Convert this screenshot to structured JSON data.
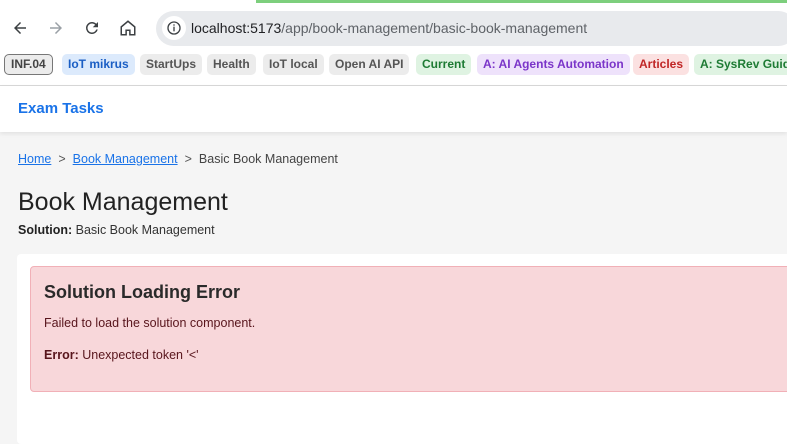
{
  "browser": {
    "url_host": "localhost:5173",
    "url_path": "/app/book-management/basic-book-management",
    "bookmarks": [
      {
        "label": "INF.04",
        "style": "outline"
      },
      {
        "label": "IoT mikrus",
        "style": "blue"
      },
      {
        "label": "StartUps",
        "style": "gray"
      },
      {
        "label": "Health",
        "style": "gray"
      },
      {
        "label": "IoT local",
        "style": "gray"
      },
      {
        "label": "Open AI API",
        "style": "gray"
      },
      {
        "label": "Current",
        "style": "green"
      },
      {
        "label": "A: AI Agents Automation",
        "style": "purple"
      },
      {
        "label": "Articles",
        "style": "red"
      },
      {
        "label": "A: SysRev Guide",
        "style": "green"
      }
    ]
  },
  "app": {
    "brand": "Exam Tasks"
  },
  "breadcrumb": {
    "home": "Home",
    "sep1": ">",
    "section": "Book Management",
    "sep2": ">",
    "current": "Basic Book Management"
  },
  "page": {
    "title": "Book Management",
    "subtitle_label": "Solution:",
    "subtitle_value": "Basic Book Management"
  },
  "error": {
    "title": "Solution Loading Error",
    "message": "Failed to load the solution component.",
    "detail_label": "Error:",
    "detail_value": "Unexpected token '<'"
  },
  "colors": {
    "accent": "#1a73e8",
    "error_bg": "#f8d7da",
    "error_border": "#f1b0b7",
    "error_text": "#58151c"
  }
}
